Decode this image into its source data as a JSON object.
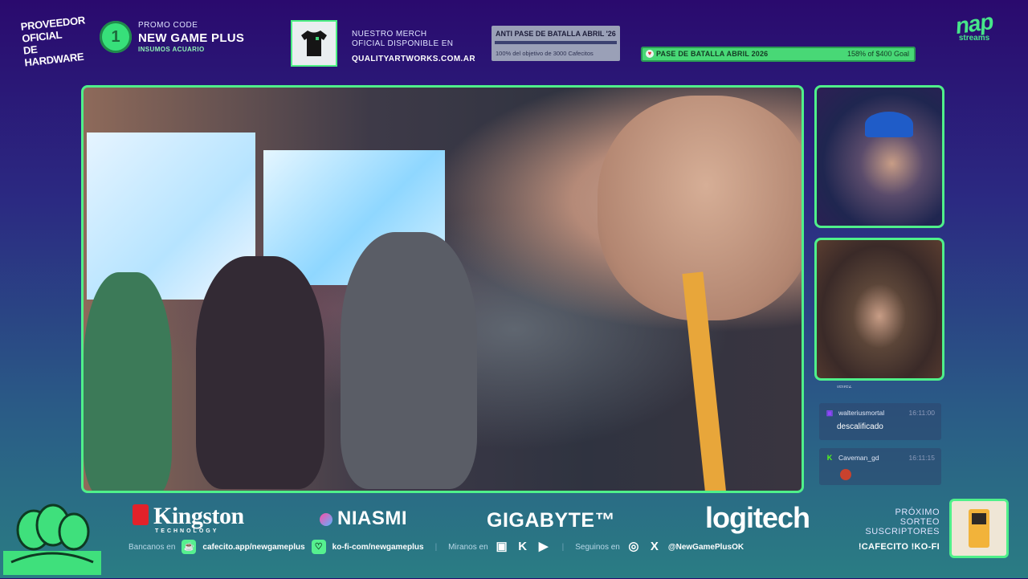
{
  "header": {
    "hardware_label": "PROVEEDOR OFICIAL DE HARDWARE",
    "promo_icon_glyph": "1",
    "promo": {
      "label": "PROMO CODE",
      "code": "NEW GAME PLUS",
      "sub": "INSUMOS ACUARIO"
    },
    "merch": {
      "line1": "NUESTRO MERCH",
      "line2": "OFICIAL DISPONIBLE EN",
      "url": "QUALITYARTWORKS.COM.AR"
    },
    "anti_pass": {
      "title": "ANTI PASE DE BATALLA ABRIL '26",
      "status": "100% del objetivo de 3000 Cafecitos",
      "progress_percent": 100
    },
    "battle_pass_goal": {
      "heart_glyph": "♥",
      "label": "PASE DE BATALLA ABRIL 2026",
      "value": "158% of $400 Goal"
    },
    "brand": {
      "logo": "nap",
      "sub": "streams"
    }
  },
  "chat": {
    "previous_fragment": "tellez",
    "messages": [
      {
        "platform_icon_glyph": "▣",
        "platform_icon": "twitch-icon",
        "user": "walteriusmortal",
        "time": "16:11:00",
        "text": "descalificado"
      },
      {
        "platform_icon_glyph": "K",
        "platform_icon": "kick-icon",
        "user": "Caveman_gd",
        "time": "16:11:15",
        "emote": "emote"
      }
    ]
  },
  "footer": {
    "sponsors": {
      "kingston": "Kingston",
      "kingston_sub": "TECHNOLOGY",
      "niasmi": "NIASMI",
      "gigabyte": "GIGABYTE™",
      "logitech": "logitech"
    },
    "links": {
      "bancanos": "Bancanos en",
      "cafecito_glyph": "☕",
      "cafecito": "cafecito.app/newgameplus",
      "kofi_glyph": "♡",
      "kofi": "ko-fi-com/newgameplus",
      "sep": "|",
      "miranos": "Miranos en",
      "twitch_glyph": "▣",
      "kick_glyph": "K",
      "youtube_glyph": "▶",
      "seguinos": "Seguinos en",
      "instagram_glyph": "◎",
      "x_glyph": "X",
      "handle": "@NewGamePlusOK"
    },
    "sorteo": {
      "line1": "PRÓXIMO",
      "line2": "SORTEO",
      "line3": "SUSCRIPTORES",
      "commands": "!CAFECITO !KO-FI"
    }
  },
  "colors": {
    "accent": "#4ff08a",
    "bg_top": "#2a0a6e",
    "bg_bottom": "#2a7d84"
  }
}
